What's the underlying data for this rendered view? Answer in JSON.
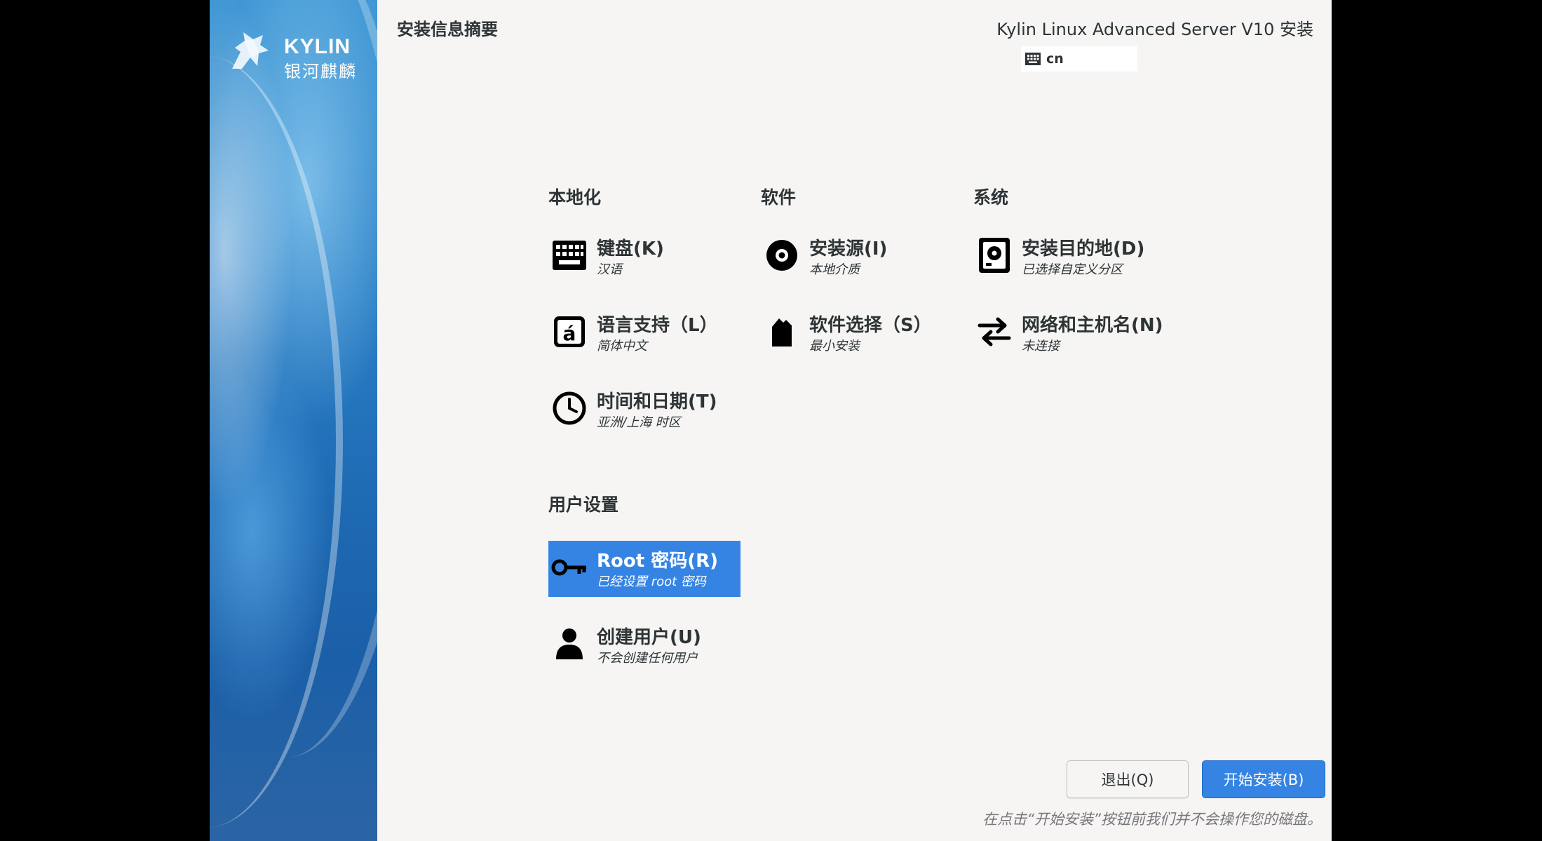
{
  "sidebar": {
    "logo_en": "KYLIN",
    "logo_cn": "银河麒麟"
  },
  "header": {
    "page_title": "安装信息摘要",
    "product_title": "Kylin Linux Advanced Server V10 安装",
    "keyboard_layout": "cn"
  },
  "sections": {
    "localization": {
      "title": "本地化",
      "keyboard": {
        "title": "键盘(K)",
        "status": "汉语",
        "icon": "keyboard-icon"
      },
      "language": {
        "title": "语言支持（L）",
        "status": "简体中文",
        "icon": "language-icon"
      },
      "datetime": {
        "title": "时间和日期(T)",
        "status": "亚洲/上海 时区",
        "icon": "clock-icon"
      }
    },
    "software": {
      "title": "软件",
      "source": {
        "title": "安装源(I)",
        "status": "本地介质",
        "icon": "disc-icon"
      },
      "selection": {
        "title": "软件选择（S）",
        "status": "最小安装",
        "icon": "package-icon"
      }
    },
    "system": {
      "title": "系统",
      "destination": {
        "title": "安装目的地(D)",
        "status": "已选择自定义分区",
        "icon": "harddisk-icon"
      },
      "network": {
        "title": "网络和主机名(N)",
        "status": "未连接",
        "icon": "network-arrows-icon"
      }
    },
    "user": {
      "title": "用户设置",
      "root": {
        "title": "Root 密码(R)",
        "status": "已经设置 root 密码",
        "icon": "key-icon"
      },
      "create_user": {
        "title": "创建用户(U)",
        "status": "不会创建任何用户",
        "icon": "user-icon"
      }
    }
  },
  "footer": {
    "quit_label": "退出(Q)",
    "begin_label": "开始安装(B)",
    "note": "在点击“开始安装”按钮前我们并不会操作您的磁盘。"
  },
  "colors": {
    "accent": "#3584e4",
    "background": "#f6f5f4",
    "sidebar_blue": "#2a7fc6",
    "text": "#2e3436"
  }
}
